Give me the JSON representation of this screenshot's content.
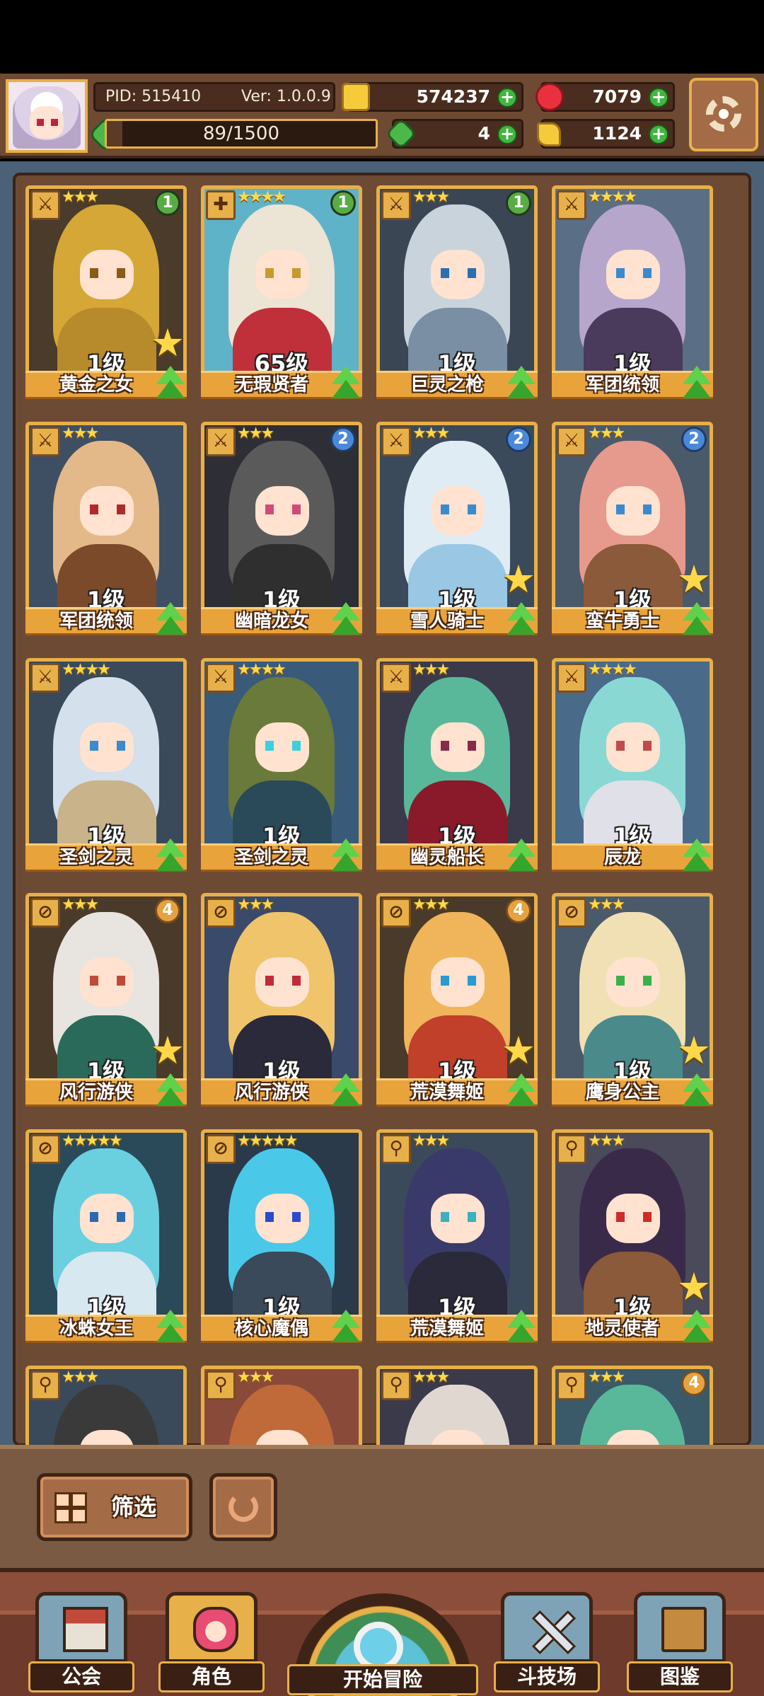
{
  "header": {
    "pid_label": "PID: 515410",
    "version_label": "Ver: 1.0.0.9",
    "energy": "89/1500",
    "energy_fraction": 0.059,
    "coins": "574237",
    "gems": "7079",
    "clovers": "4",
    "tickets": "1124"
  },
  "cards": [
    {
      "name": "黄金之女",
      "level": "1级",
      "stars": "★★★",
      "rank": "1",
      "rank_color": "r1",
      "star_badge": true,
      "role": "⚔",
      "hair": "#d4a736",
      "eye": "#8a5b16",
      "body": "#b78b2c",
      "bg": "#4a3b2a"
    },
    {
      "name": "无瑕贤者",
      "level": "65级",
      "stars": "★★★★",
      "rank": "1",
      "rank_color": "r1",
      "star_badge": false,
      "role": "✚",
      "hair": "#ece4d4",
      "eye": "#c89a2a",
      "body": "#c0303a",
      "bg": "#5fb3c9"
    },
    {
      "name": "巨灵之枪",
      "level": "1级",
      "stars": "★★★",
      "rank": "1",
      "rank_color": "r1",
      "star_badge": false,
      "role": "⚔",
      "hair": "#c9d3dc",
      "eye": "#2a6fb0",
      "body": "#7a8fa3",
      "bg": "#3a4654"
    },
    {
      "name": "军团统领",
      "level": "1级",
      "stars": "★★★★",
      "rank": "",
      "rank_color": "",
      "star_badge": false,
      "role": "⚔",
      "hair": "#b7a6cc",
      "eye": "#3a8ad0",
      "body": "#4a3b5c",
      "bg": "#5a6f86"
    },
    {
      "name": "军团统领",
      "level": "1级",
      "stars": "★★★",
      "rank": "",
      "rank_color": "",
      "star_badge": false,
      "role": "⚔",
      "hair": "#e3b98a",
      "eye": "#b02a2a",
      "body": "#7a4a2a",
      "bg": "#3f4f63"
    },
    {
      "name": "幽暗龙女",
      "level": "1级",
      "stars": "★★★",
      "rank": "2",
      "rank_color": "r2",
      "star_badge": false,
      "role": "⚔",
      "hair": "#5a5a5a",
      "eye": "#d04a7a",
      "body": "#2f2f2f",
      "bg": "#2e2e36"
    },
    {
      "name": "雪人骑士",
      "level": "1级",
      "stars": "★★★",
      "rank": "2",
      "rank_color": "r2",
      "star_badge": true,
      "role": "⚔",
      "hair": "#e0ecf4",
      "eye": "#3a8ad0",
      "body": "#9ac8e4",
      "bg": "#3a4a5a"
    },
    {
      "name": "蛮牛勇士",
      "level": "1级",
      "stars": "★★★",
      "rank": "2",
      "rank_color": "r2",
      "star_badge": true,
      "role": "⚔",
      "hair": "#e69a8e",
      "eye": "#3a8ad0",
      "body": "#8a5a3a",
      "bg": "#4a5a6a"
    },
    {
      "name": "圣剑之灵",
      "level": "1级",
      "stars": "★★★★",
      "rank": "",
      "rank_color": "",
      "star_badge": false,
      "role": "⚔",
      "hair": "#d4e0ec",
      "eye": "#3a8ad0",
      "body": "#c9b38a",
      "bg": "#3a4a5a"
    },
    {
      "name": "圣剑之灵",
      "level": "1级",
      "stars": "★★★★",
      "rank": "",
      "rank_color": "",
      "star_badge": false,
      "role": "⚔",
      "hair": "#6a7a3a",
      "eye": "#3ad0e0",
      "body": "#2a4a5a",
      "bg": "#3a5a7a"
    },
    {
      "name": "幽灵船长",
      "level": "1级",
      "stars": "★★★",
      "rank": "",
      "rank_color": "",
      "star_badge": false,
      "role": "⚔",
      "hair": "#5ab89a",
      "eye": "#8a2a4a",
      "body": "#8a1a2a",
      "bg": "#3a3a4a"
    },
    {
      "name": "辰龙",
      "level": "1级",
      "stars": "★★★★",
      "rank": "",
      "rank_color": "",
      "star_badge": false,
      "role": "⚔",
      "hair": "#8ad8d4",
      "eye": "#c04a4a",
      "body": "#e0e0e8",
      "bg": "#4a6a8a"
    },
    {
      "name": "风行游侠",
      "level": "1级",
      "stars": "★★★",
      "rank": "4",
      "rank_color": "r4",
      "star_badge": true,
      "role": "⊘",
      "hair": "#e8e4e0",
      "eye": "#c04a3a",
      "body": "#2a6a5a",
      "bg": "#4a3a2a"
    },
    {
      "name": "风行游侠",
      "level": "1级",
      "stars": "★★★",
      "rank": "",
      "rank_color": "",
      "star_badge": false,
      "role": "⊘",
      "hair": "#f0c46a",
      "eye": "#c02a3a",
      "body": "#2a2a3a",
      "bg": "#3a4a6a"
    },
    {
      "name": "荒漠舞姬",
      "level": "1级",
      "stars": "★★★",
      "rank": "4",
      "rank_color": "r4",
      "star_badge": true,
      "role": "⊘",
      "hair": "#f0b45a",
      "eye": "#2a9ad0",
      "body": "#c0402a",
      "bg": "#4a3a2a"
    },
    {
      "name": "鹰身公主",
      "level": "1级",
      "stars": "★★★",
      "rank": "",
      "rank_color": "",
      "star_badge": true,
      "role": "⊘",
      "hair": "#f0e0b4",
      "eye": "#3ab04a",
      "body": "#4a8a8a",
      "bg": "#4a5a6a"
    },
    {
      "name": "冰蛛女王",
      "level": "1级",
      "stars": "★★★★★",
      "rank": "",
      "rank_color": "",
      "star_badge": false,
      "role": "⊘",
      "hair": "#6ad0e0",
      "eye": "#2a6ab0",
      "body": "#d8e8f0",
      "bg": "#2a4a5a"
    },
    {
      "name": "核心魔偶",
      "level": "1级",
      "stars": "★★★★★",
      "rank": "",
      "rank_color": "",
      "star_badge": false,
      "role": "⊘",
      "hair": "#4ac8e8",
      "eye": "#2a4ad0",
      "body": "#3a4a5a",
      "bg": "#2a3a4a"
    },
    {
      "name": "荒漠舞姬",
      "level": "1级",
      "stars": "★★★",
      "rank": "",
      "rank_color": "",
      "star_badge": false,
      "role": "⚲",
      "hair": "#3a3a6a",
      "eye": "#3ab0c0",
      "body": "#2a2a3a",
      "bg": "#3a4a5a"
    },
    {
      "name": "地灵使者",
      "level": "1级",
      "stars": "★★★",
      "rank": "",
      "rank_color": "",
      "star_badge": true,
      "role": "⚲",
      "hair": "#3a2a4a",
      "eye": "#d02a2a",
      "body": "#8a5a3a",
      "bg": "#4a4a5a"
    },
    {
      "name": "",
      "level": "",
      "stars": "★★★",
      "rank": "",
      "rank_color": "",
      "star_badge": false,
      "role": "⚲",
      "hair": "#3a3a3a",
      "eye": "#d02a2a",
      "body": "#2a2a2a",
      "bg": "#3a4a5a"
    },
    {
      "name": "",
      "level": "",
      "stars": "★★★",
      "rank": "",
      "rank_color": "",
      "star_badge": false,
      "role": "⚲",
      "hair": "#c06a3a",
      "eye": "#3a3a3a",
      "body": "#8a4a2a",
      "bg": "#8a4a3a"
    },
    {
      "name": "",
      "level": "",
      "stars": "★★★",
      "rank": "",
      "rank_color": "",
      "star_badge": false,
      "role": "⚲",
      "hair": "#e0d8d0",
      "eye": "#3ab04a",
      "body": "#2a2a3a",
      "bg": "#3a3a4a"
    },
    {
      "name": "",
      "level": "",
      "stars": "★★★",
      "rank": "4",
      "rank_color": "r4",
      "star_badge": false,
      "role": "⚲",
      "hair": "#5ab89a",
      "eye": "#c04a6a",
      "body": "#3a6a5a",
      "bg": "#3a5a6a"
    }
  ],
  "filter": {
    "label": "筛选"
  },
  "nav": {
    "guild": "公会",
    "role": "角色",
    "adventure": "开始冒险",
    "arena": "斗技场",
    "codex": "图鉴"
  },
  "colors": {
    "gold_frame": "#e8b048",
    "panel_brown": "#6d4a34",
    "plus_green": "#41b640"
  },
  "icons": {
    "coin": "coin-icon",
    "gem": "gem-icon",
    "clover": "clover-icon",
    "ticket": "ticket-icon",
    "settings": "gear-icon"
  }
}
